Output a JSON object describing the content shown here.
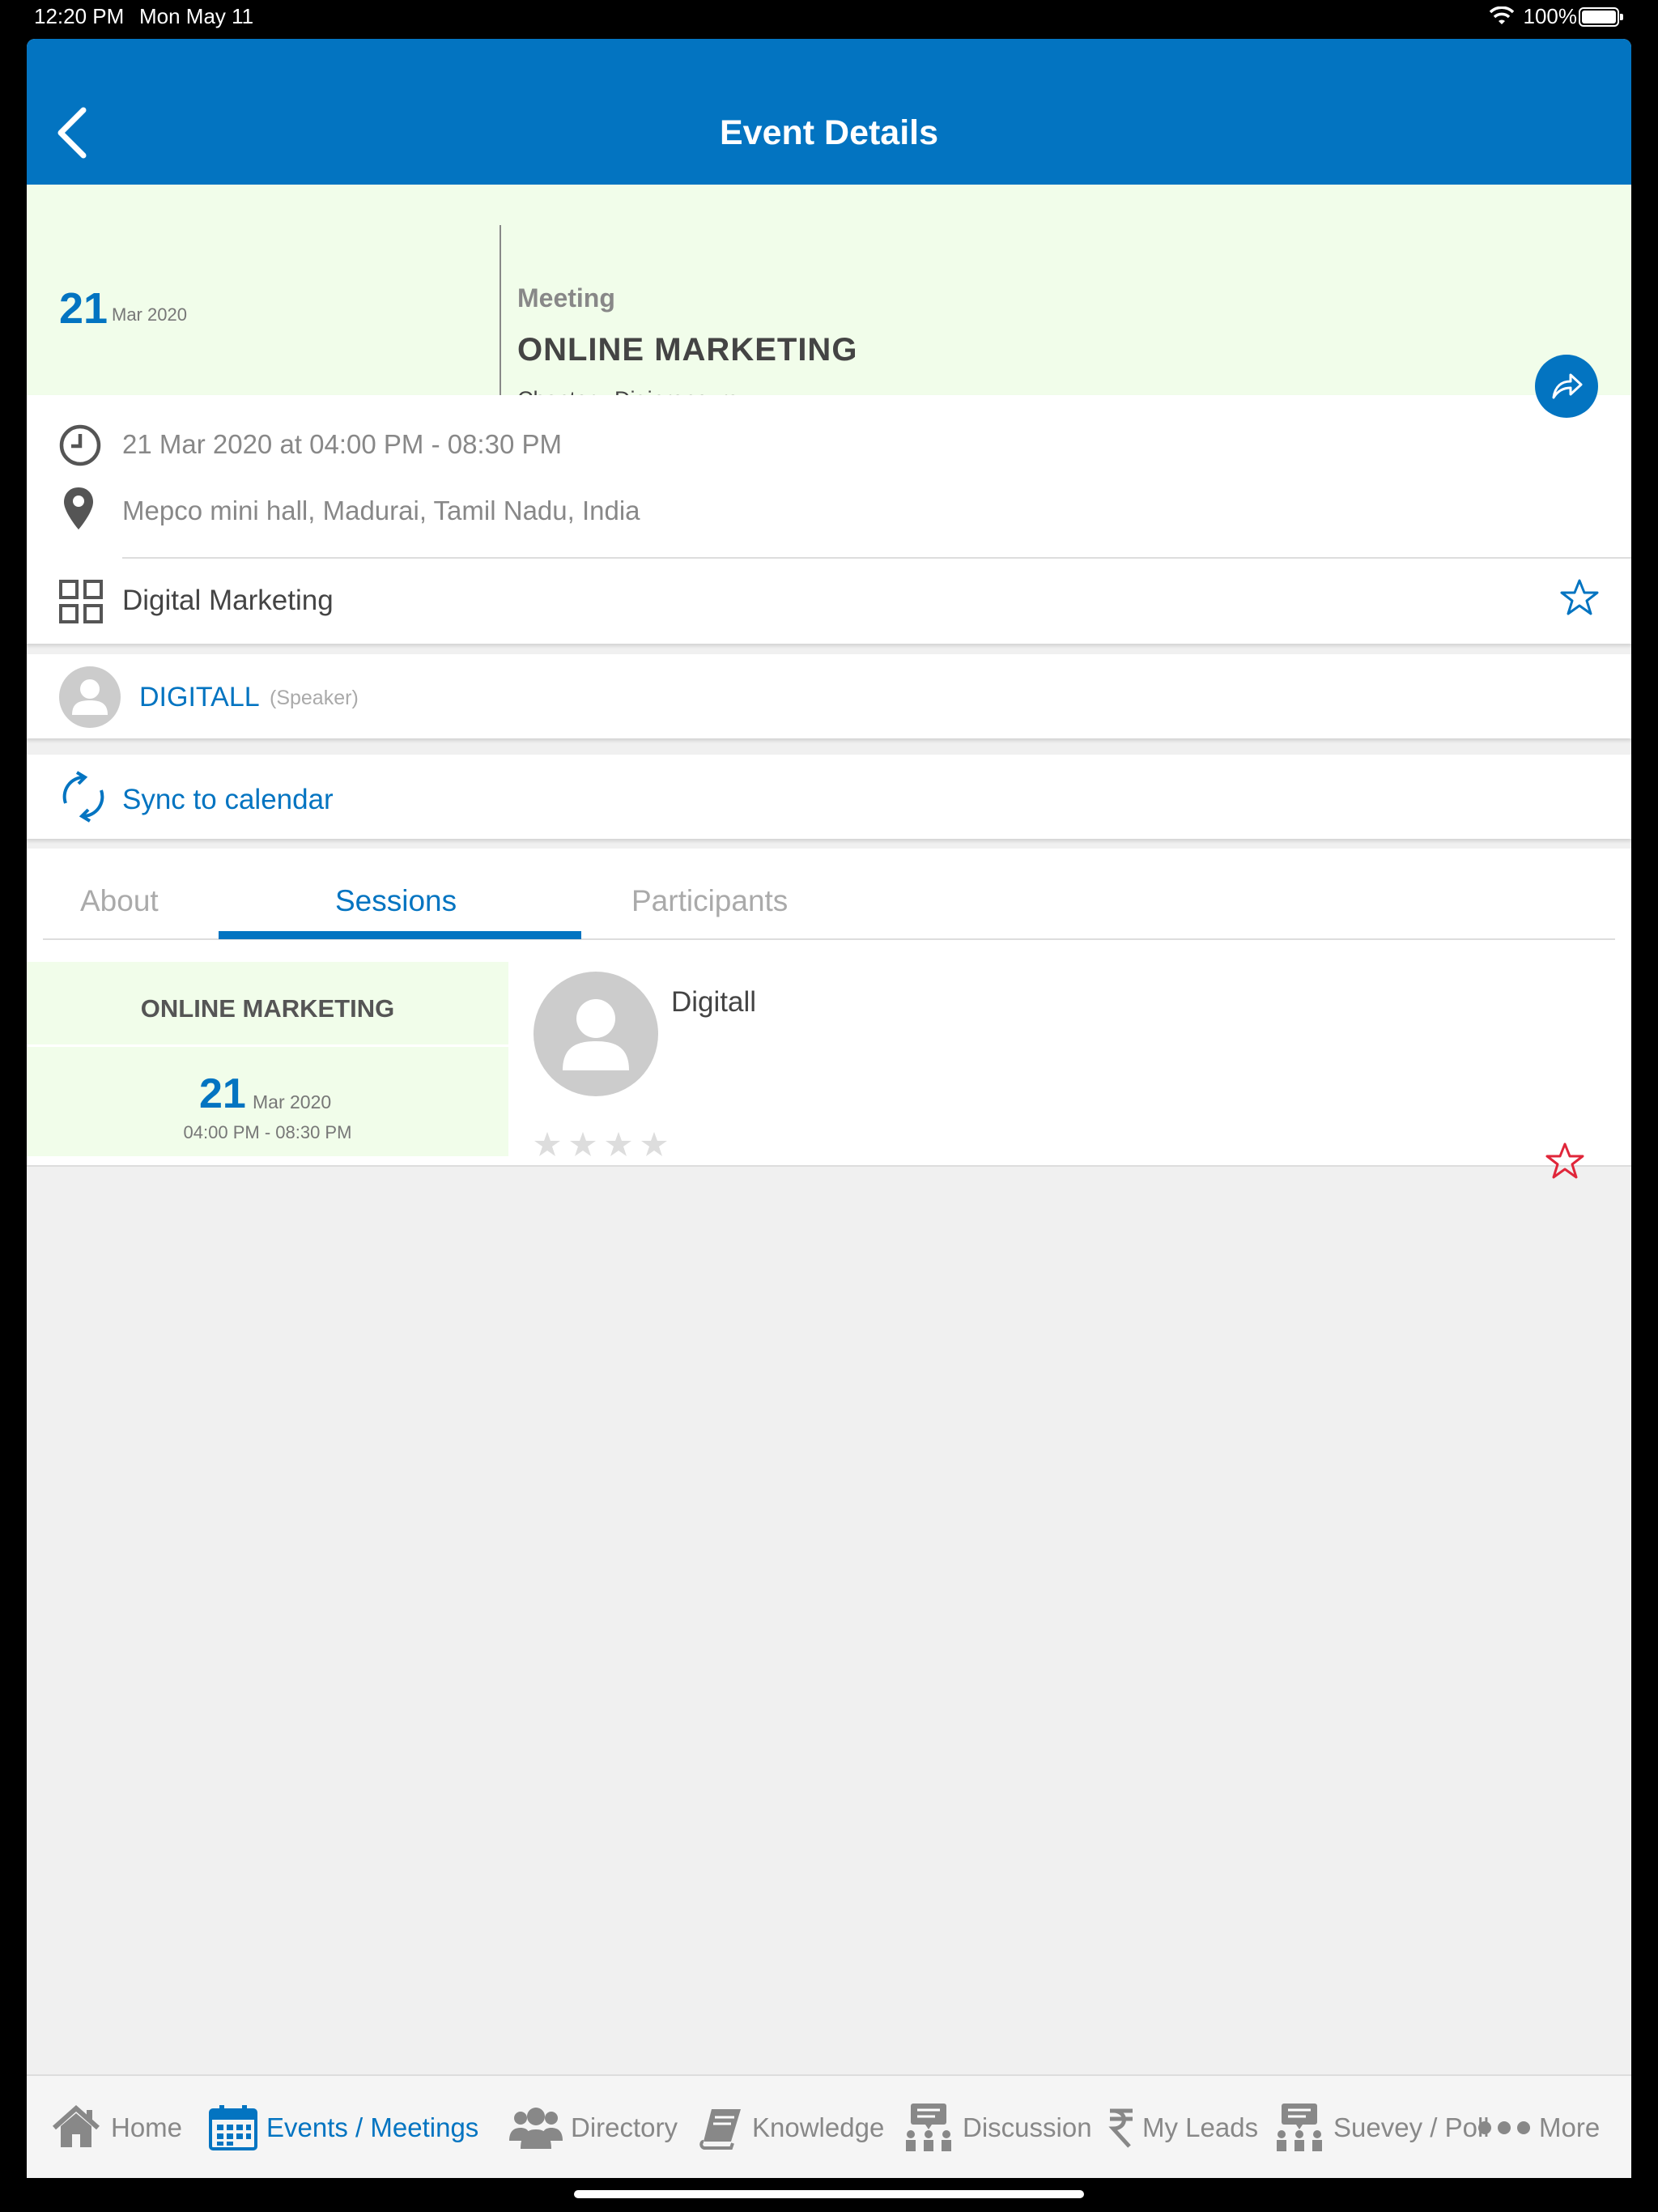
{
  "status_bar": {
    "time": "12:20 PM",
    "date": "Mon May 11",
    "battery": "100%"
  },
  "header": {
    "title": "Event Details"
  },
  "event": {
    "day": "21",
    "month_year": "Mar 2020",
    "type": "Meeting",
    "name": "ONLINE MARKETING",
    "chapter": "Chapter - Digipreneurs",
    "datetime": "21 Mar 2020 at 04:00 PM - 08:30 PM",
    "location": "Mepco mini hall, Madurai, Tamil Nadu, India",
    "category": "Digital Marketing"
  },
  "speaker": {
    "name": "DIGITALL",
    "role": "(Speaker)"
  },
  "sync": {
    "label": "Sync to calendar"
  },
  "tabs": [
    {
      "label": "About",
      "active": false
    },
    {
      "label": "Sessions",
      "active": true
    },
    {
      "label": "Participants",
      "active": false
    }
  ],
  "session": {
    "name": "ONLINE MARKETING",
    "day": "21",
    "month_year": "Mar 2020",
    "time": "04:00 PM - 08:30 PM",
    "presenter": "Digitall",
    "rating": 0,
    "max_rating": 4
  },
  "bottom_nav": [
    {
      "label": "Home",
      "icon": "home-icon",
      "active": false
    },
    {
      "label": "Events / Meetings",
      "icon": "calendar-icon",
      "active": true
    },
    {
      "label": "Directory",
      "icon": "people-icon",
      "active": false
    },
    {
      "label": "Knowledge",
      "icon": "book-icon",
      "active": false
    },
    {
      "label": "Discussion",
      "icon": "discussion-icon",
      "active": false
    },
    {
      "label": "My Leads",
      "icon": "rupee-icon",
      "active": false
    },
    {
      "label": "Suevey / Poll",
      "icon": "poll-icon",
      "active": false
    },
    {
      "label": "More",
      "icon": "more-dots-icon",
      "active": false
    }
  ],
  "colors": {
    "primary": "#0374c1",
    "highlight_bg": "#f1fdea",
    "favorite_red": "#e0263a"
  }
}
